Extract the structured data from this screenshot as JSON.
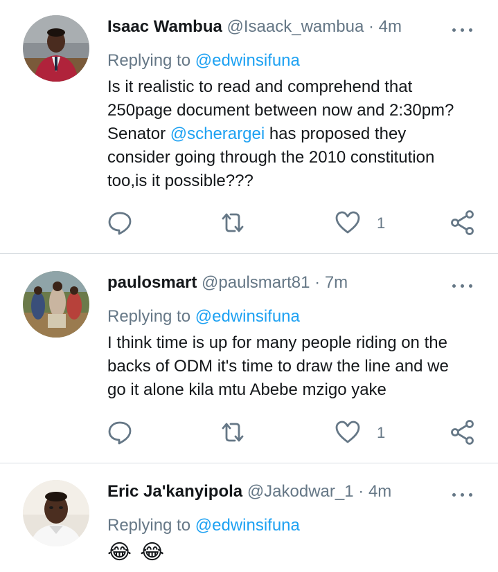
{
  "colors": {
    "accent": "#1da1f2",
    "muted": "#657786",
    "divider": "#d9dee2"
  },
  "tweets": [
    {
      "name": "Isaac Wambua",
      "handle": "@Isaack_wambua",
      "dot": "·",
      "time": "4m",
      "replying_prefix": "Replying to",
      "replying_handle": "@edwinsifuna",
      "body_line1": "Is it realistic to read and comprehend that",
      "body_line2": "250page document between now and 2:30pm?",
      "body_line3_pre": "Senator ",
      "body_line3_mention": "@scherargei",
      "body_line3_post": " has proposed they",
      "body_line4": "consider going through the 2010 constitution",
      "body_line5": "too,is it possible???",
      "like_count": "1"
    },
    {
      "name": "paulosmart",
      "handle": "@paulsmart81",
      "dot": "·",
      "time": "7m",
      "replying_prefix": "Replying to",
      "replying_handle": "@edwinsifuna",
      "body_line1": "I think time is up for many people riding on the",
      "body_line2": "backs of ODM it's time to draw the line and we",
      "body_line3": "go it alone kila mtu Abebe mzigo yake",
      "like_count": "1"
    },
    {
      "name": "Eric Ja'kanyipola",
      "handle": "@Jakodwar_1",
      "dot": "·",
      "time": "4m",
      "replying_prefix": "Replying to",
      "replying_handle": "@edwinsifuna",
      "emoji_1": "😂",
      "emoji_2": "😂"
    }
  ],
  "icons": [
    "reply-icon",
    "retweet-icon",
    "like-icon",
    "share-icon",
    "more-icon"
  ]
}
